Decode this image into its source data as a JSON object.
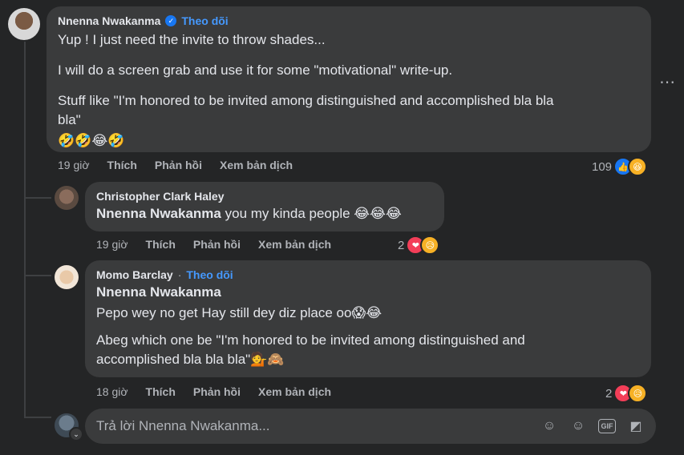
{
  "comment1": {
    "author": "Nnenna Nwakanma",
    "follow": "Theo dõi",
    "lines": [
      "Yup ! I just need the invite to throw shades...",
      "I will do a screen grab and use it for some \"motivational\" write-up.",
      "Stuff like \"I'm honored to be invited among distinguished and accomplished bla bla",
      "bla\""
    ],
    "emoji": "🤣🤣😂🤣",
    "time": "19 giờ",
    "like": "Thích",
    "reply": "Phản hồi",
    "translate": "Xem bản dịch",
    "reaction_count": "109"
  },
  "reply1": {
    "author": "Christopher Clark Haley",
    "mention": "Nnenna Nwakanma",
    "text": " you my kinda people ",
    "emoji": "😂😂😂",
    "time": "19 giờ",
    "like": "Thích",
    "reply": "Phản hồi",
    "translate": "Xem bản dịch",
    "reaction_count": "2"
  },
  "reply2": {
    "author": "Momo Barclay",
    "dot": "·",
    "follow": "Theo dõi",
    "mention": "Nnenna Nwakanma",
    "line1": "Pepo wey no get Hay still dey diz place oo",
    "line1_emoji": "😱😂",
    "line2a": "Abeg which one be \"I'm honored to be invited among distinguished and",
    "line2b": "accomplished bla bla bla\"",
    "line2_emoji": "💁🙈",
    "time": "18 giờ",
    "like": "Thích",
    "reply": "Phản hồi",
    "translate": "Xem bản dịch",
    "reaction_count": "2"
  },
  "reply_box": {
    "placeholder": "Trả lời Nnenna Nwakanma..."
  },
  "icons": {
    "more": "more-options-icon",
    "like": "like-reaction-icon",
    "haha": "haha-reaction-icon",
    "love": "love-reaction-icon",
    "care": "care-reaction-icon",
    "verified": "verified-badge-icon",
    "avatar_sticker": "avatar-sticker-icon",
    "emoji": "emoji-icon",
    "gif": "gif-icon",
    "sticker": "sticker-icon"
  },
  "colors": {
    "background": "#242526",
    "bubble": "#3a3b3c",
    "link": "#4599ff",
    "like_blue": "#1877f2",
    "love_red": "#f33e58"
  }
}
